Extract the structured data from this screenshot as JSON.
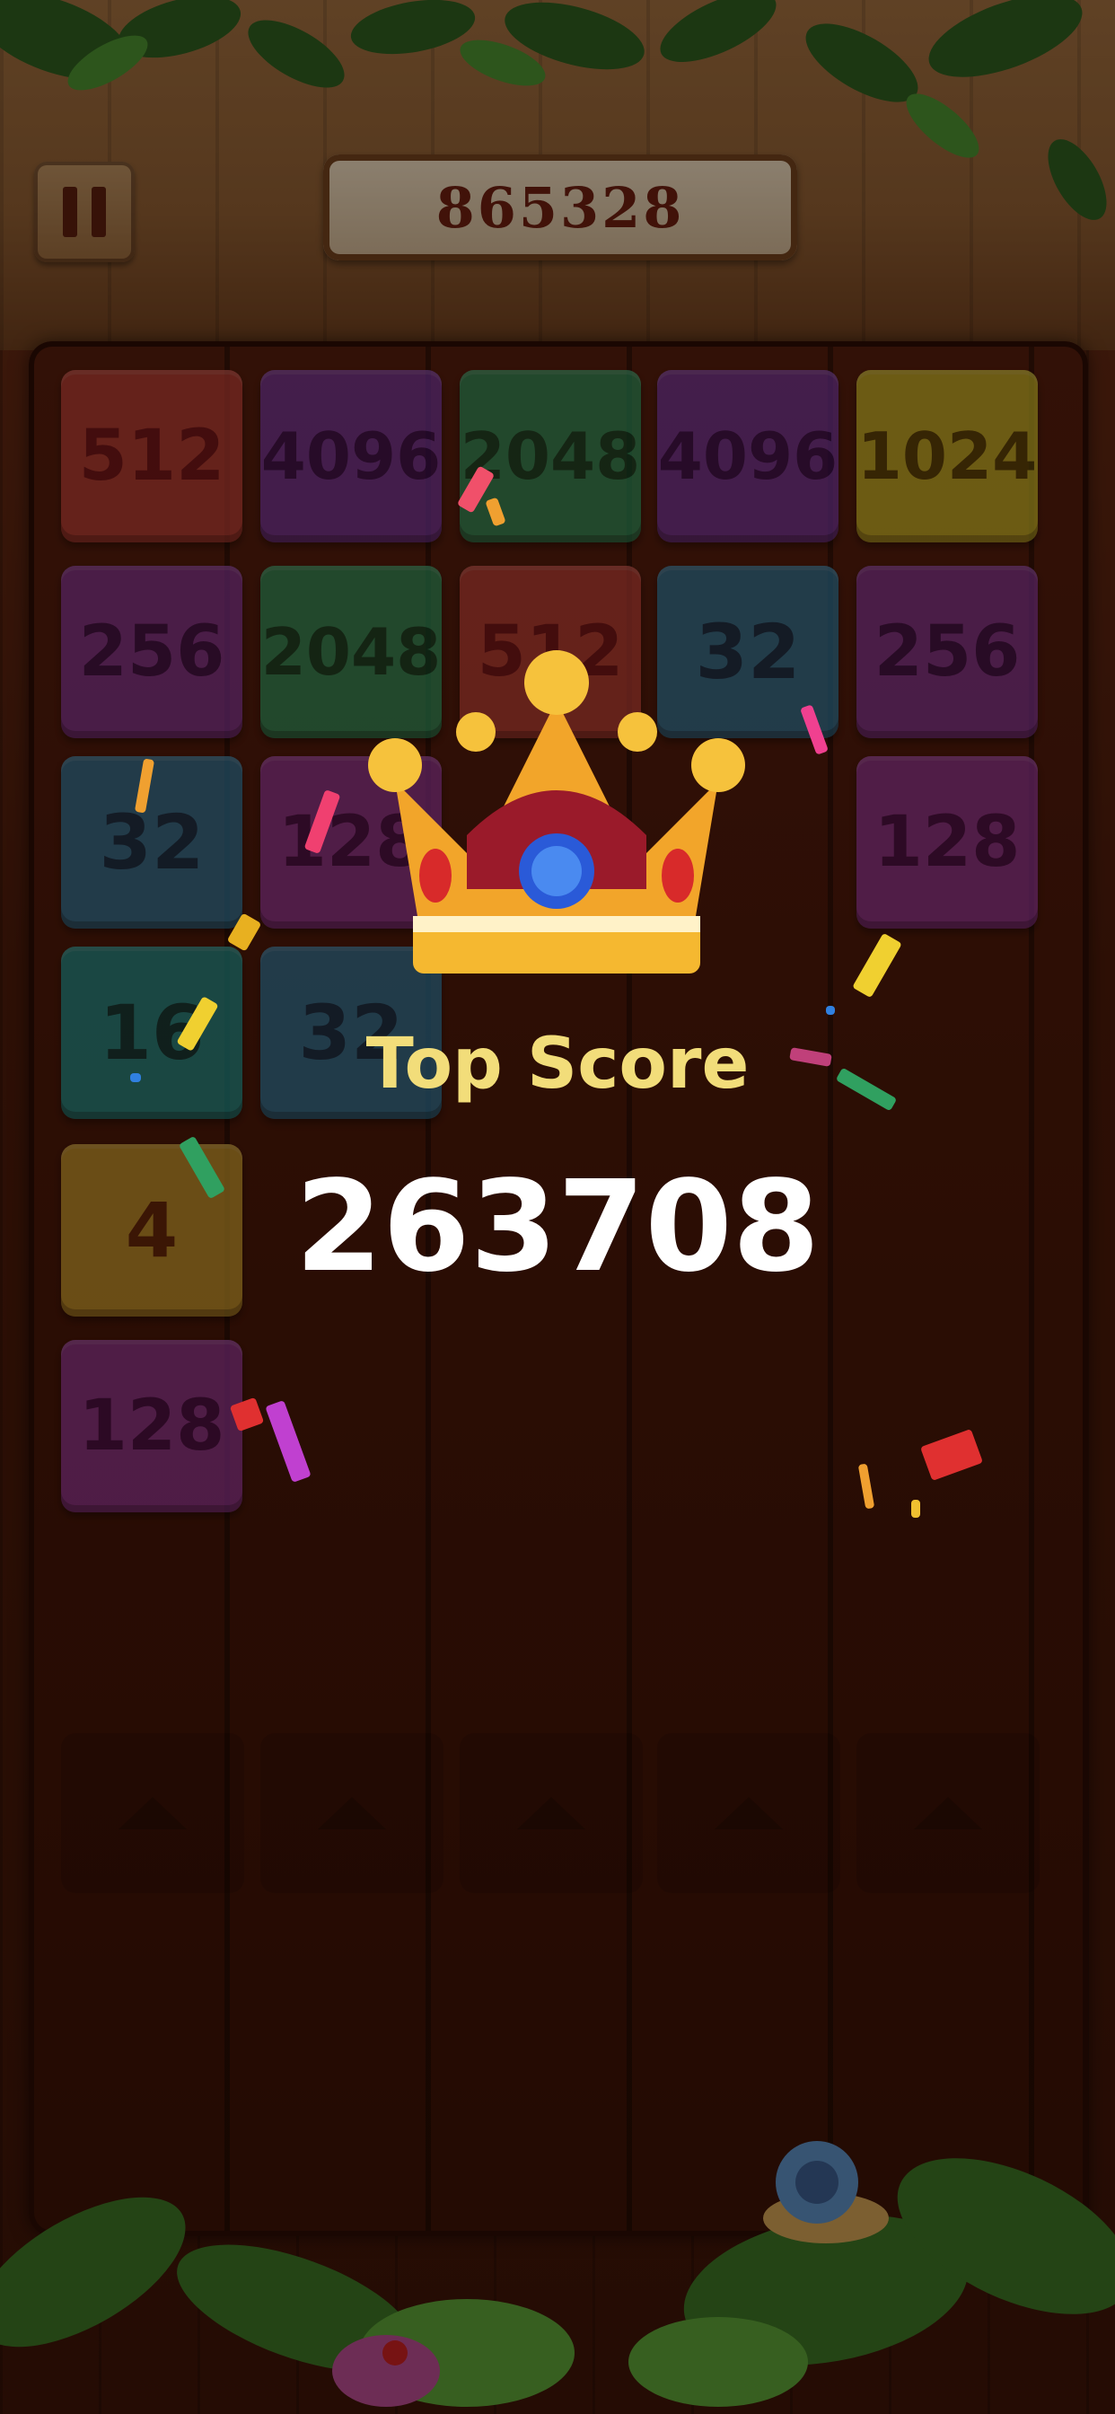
{
  "hud": {
    "score": "865328",
    "pause_icon": "pause-icon"
  },
  "board": {
    "tiles": [
      {
        "value": "512",
        "col": 0,
        "row": 0,
        "color": "#c7443a",
        "text": "#7a141c"
      },
      {
        "value": "4096",
        "col": 1,
        "row": 0,
        "color": "#7a3aa8",
        "text": "#3a1058"
      },
      {
        "value": "2048",
        "col": 2,
        "row": 0,
        "color": "#2e9a62",
        "text": "#0f4a2a"
      },
      {
        "value": "4096",
        "col": 3,
        "row": 0,
        "color": "#7a3aa8",
        "text": "#3a1058"
      },
      {
        "value": "1024",
        "col": 4,
        "row": 0,
        "color": "#d8c62a",
        "text": "#5a4a08"
      },
      {
        "value": "256",
        "col": 0,
        "row": 1,
        "color": "#8a3aa0",
        "text": "#3e0f52"
      },
      {
        "value": "2048",
        "col": 1,
        "row": 1,
        "color": "#2e9a62",
        "text": "#0f4a2a"
      },
      {
        "value": "512",
        "col": 2,
        "row": 1,
        "color": "#c7443a",
        "text": "#7a141c"
      },
      {
        "value": "32",
        "col": 3,
        "row": 1,
        "color": "#2f7fa6",
        "text": "#0f3552"
      },
      {
        "value": "256",
        "col": 4,
        "row": 1,
        "color": "#8a3aa0",
        "text": "#3e0f52"
      },
      {
        "value": "32",
        "col": 0,
        "row": 2,
        "color": "#2f7fa6",
        "text": "#0f3552"
      },
      {
        "value": "128",
        "col": 1,
        "row": 2,
        "color": "#9a3aa0",
        "text": "#4a0f52"
      },
      {
        "value": "128",
        "col": 4,
        "row": 2,
        "color": "#9a3aa0",
        "text": "#4a0f52"
      },
      {
        "value": "16",
        "col": 0,
        "row": 3,
        "color": "#1f9a96",
        "text": "#08403e"
      },
      {
        "value": "32",
        "col": 1,
        "row": 3,
        "color": "#2f7fa6",
        "text": "#0f3552"
      },
      {
        "value": "4",
        "col": 0,
        "row": 4,
        "color": "#d8a830",
        "text": "#6a2a0a"
      },
      {
        "value": "128",
        "col": 0,
        "row": 5,
        "color": "#9a3aa0",
        "text": "#4a0f52"
      }
    ],
    "shooter_slots": 5
  },
  "overlay": {
    "crown_icon": "crown-icon",
    "top_score_label": "Top Score",
    "top_score_value": "263708"
  }
}
